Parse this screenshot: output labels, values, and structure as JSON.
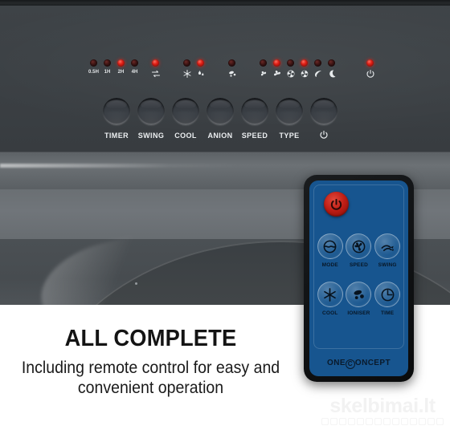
{
  "product": {
    "brand": "ONECONCEPT",
    "brand_mark": "C"
  },
  "control_panel": {
    "led_groups": [
      {
        "name": "timer",
        "leds": [
          {
            "label": "0.5H",
            "state": "off"
          },
          {
            "label": "1H",
            "state": "off"
          },
          {
            "label": "2H",
            "state": "on"
          },
          {
            "label": "4H",
            "state": "off"
          }
        ]
      },
      {
        "name": "swing",
        "leds": [
          {
            "icon": "swing-arrows-icon",
            "state": "on"
          }
        ]
      },
      {
        "name": "mode",
        "leds": [
          {
            "icon": "snowflake-icon",
            "state": "off"
          },
          {
            "icon": "water-drop-icon",
            "state": "on"
          }
        ]
      },
      {
        "name": "anion",
        "leds": [
          {
            "icon": "ioniser-icon",
            "state": "off"
          }
        ]
      },
      {
        "name": "speed-type",
        "leds": [
          {
            "icon": "fan-low-icon",
            "state": "off"
          },
          {
            "icon": "fan-high-icon",
            "state": "on"
          },
          {
            "icon": "fan-circle-icon",
            "state": "off"
          },
          {
            "icon": "fan-gear-icon",
            "state": "on"
          },
          {
            "icon": "leaf-icon",
            "state": "off"
          },
          {
            "icon": "moon-icon",
            "state": "off"
          }
        ]
      },
      {
        "name": "power",
        "leds": [
          {
            "icon": "power-icon",
            "state": "on"
          }
        ]
      }
    ],
    "buttons": [
      {
        "label": "TIMER",
        "icon": ""
      },
      {
        "label": "SWING",
        "icon": ""
      },
      {
        "label": "COOL",
        "icon": ""
      },
      {
        "label": "ANION",
        "icon": ""
      },
      {
        "label": "SPEED",
        "icon": ""
      },
      {
        "label": "TYPE",
        "icon": ""
      },
      {
        "label": "",
        "icon": "power-icon"
      }
    ]
  },
  "remote": {
    "power_button": "power-icon",
    "buttons": [
      {
        "label": "MODE",
        "icon": "mode-icon"
      },
      {
        "label": "SPEED",
        "icon": "fan-icon"
      },
      {
        "label": "SWING",
        "icon": "swing-icon"
      },
      {
        "label": "COOL",
        "icon": "snowflake-icon"
      },
      {
        "label": "IONISER",
        "icon": "ioniser-icon"
      },
      {
        "label": "TIME",
        "icon": "clock-icon"
      }
    ]
  },
  "caption": {
    "title": "ALL COMPLETE",
    "subtitle": "Including remote control for easy and convenient operation"
  },
  "watermark": {
    "text": "skelbimai.lt"
  },
  "colors": {
    "panel_dark": "#3b4044",
    "panel_mid": "#6c7175",
    "led_on": "#e01f16",
    "led_off": "#3d1514",
    "remote_blue": "#17558f",
    "remote_power_red": "#bf1d14",
    "caption_bg": "#ffffff",
    "caption_text": "#141414"
  }
}
